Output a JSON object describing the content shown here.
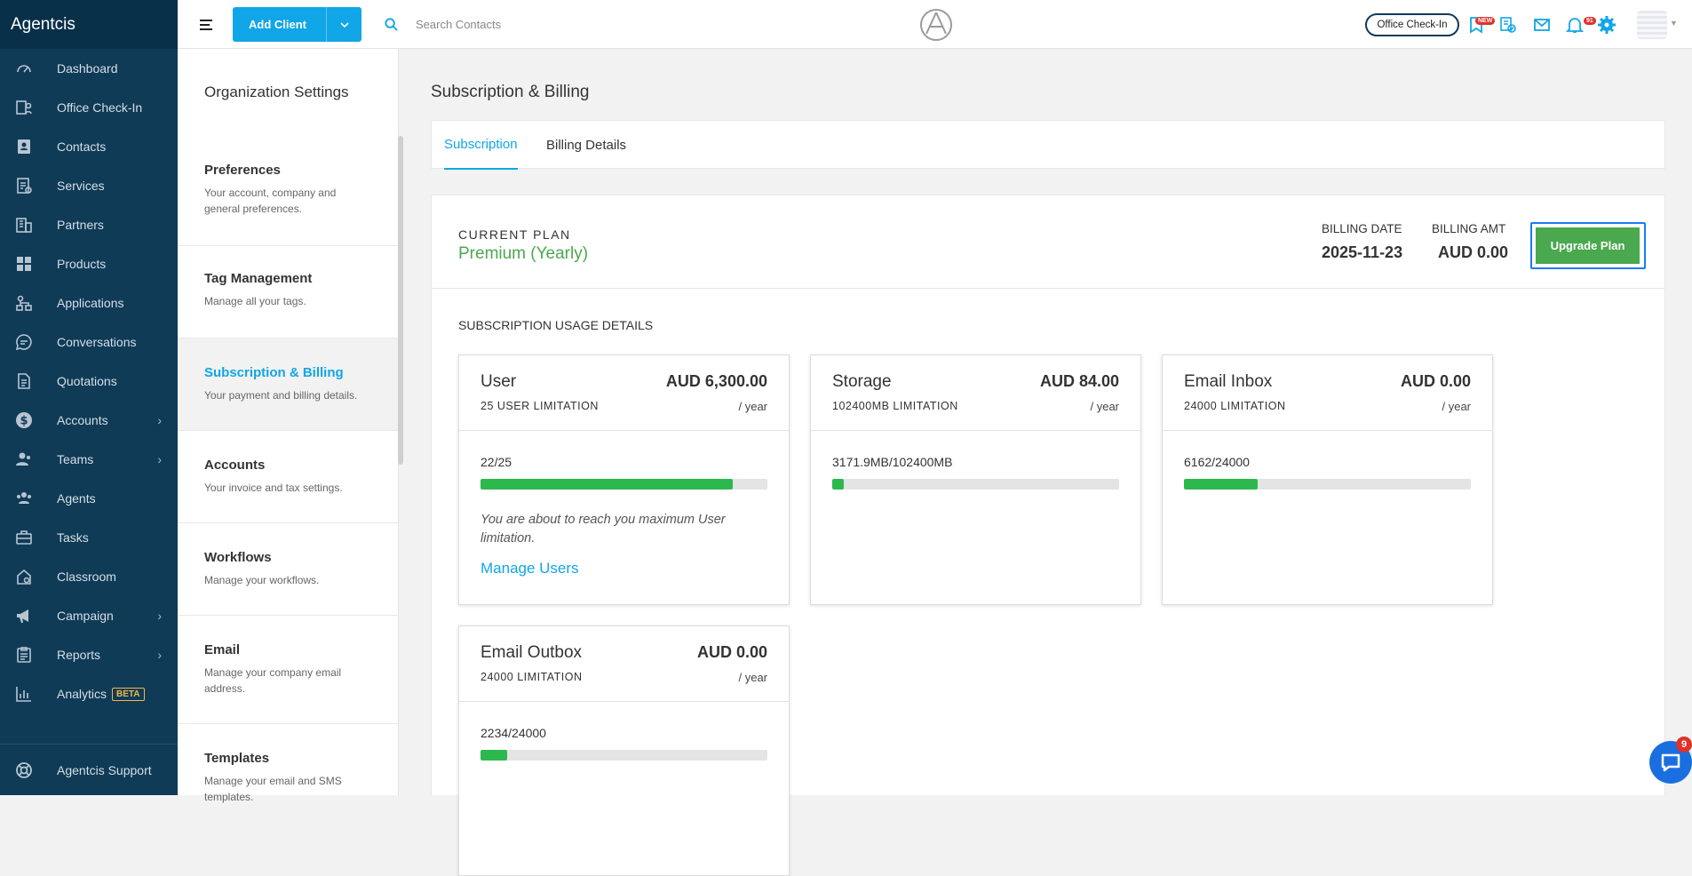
{
  "sidebar": {
    "brand": "Agentcis",
    "items": [
      {
        "label": "Dashboard",
        "icon": "gauge-icon",
        "chevron": false
      },
      {
        "label": "Office Check-In",
        "icon": "checkin-icon",
        "chevron": false
      },
      {
        "label": "Contacts",
        "icon": "contacts-icon",
        "chevron": false
      },
      {
        "label": "Services",
        "icon": "services-icon",
        "chevron": false
      },
      {
        "label": "Partners",
        "icon": "building-icon",
        "chevron": false
      },
      {
        "label": "Products",
        "icon": "products-icon",
        "chevron": false
      },
      {
        "label": "Applications",
        "icon": "applications-icon",
        "chevron": false
      },
      {
        "label": "Conversations",
        "icon": "chat-icon",
        "chevron": false
      },
      {
        "label": "Quotations",
        "icon": "document-icon",
        "chevron": false
      },
      {
        "label": "Accounts",
        "icon": "dollar-icon",
        "chevron": true
      },
      {
        "label": "Teams",
        "icon": "team-icon",
        "chevron": true
      },
      {
        "label": "Agents",
        "icon": "agents-icon",
        "chevron": false
      },
      {
        "label": "Tasks",
        "icon": "briefcase-icon",
        "chevron": false
      },
      {
        "label": "Classroom",
        "icon": "classroom-icon",
        "chevron": false
      },
      {
        "label": "Campaign",
        "icon": "megaphone-icon",
        "chevron": true
      },
      {
        "label": "Reports",
        "icon": "clipboard-icon",
        "chevron": true
      },
      {
        "label": "Analytics",
        "icon": "analytics-icon",
        "chevron": false,
        "badge": "BETA"
      }
    ],
    "support": "Agentcis Support"
  },
  "topbar": {
    "add_client": "Add Client",
    "search_placeholder": "Search Contacts",
    "office_checkin": "Office Check-In",
    "new_badge": "NEW",
    "notif_badge": "91"
  },
  "settings": {
    "title": "Organization Settings",
    "items": [
      {
        "title": "Preferences",
        "desc": "Your account, company and general preferences."
      },
      {
        "title": "Tag Management",
        "desc": "Manage all your tags."
      },
      {
        "title": "Subscription & Billing",
        "desc": "Your payment and billing details.",
        "active": true
      },
      {
        "title": "Accounts",
        "desc": "Your invoice and tax settings."
      },
      {
        "title": "Workflows",
        "desc": "Manage your workflows."
      },
      {
        "title": "Email",
        "desc": "Manage your company email address."
      },
      {
        "title": "Templates",
        "desc": "Manage your email and SMS templates."
      }
    ]
  },
  "main": {
    "title": "Subscription & Billing",
    "tabs": [
      "Subscription",
      "Billing Details"
    ],
    "current_plan_label": "CURRENT PLAN",
    "current_plan": "Premium (Yearly)",
    "billing_date_label": "BILLING DATE",
    "billing_date": "2025-11-23",
    "billing_amt_label": "BILLING AMT",
    "billing_amt": "AUD 0.00",
    "upgrade": "Upgrade Plan",
    "usage_title": "SUBSCRIPTION USAGE DETAILS",
    "cards": [
      {
        "name": "User",
        "price": "AUD 6,300.00",
        "limit": "25 USER LIMITATION",
        "per": "/ year",
        "used": "22/25",
        "fraction": 0.88,
        "warning": "You are about to reach you maximum User limitation.",
        "link": "Manage Users"
      },
      {
        "name": "Storage",
        "price": "AUD 84.00",
        "limit": "102400MB LIMITATION",
        "per": "/ year",
        "used": "3171.9MB/102400MB",
        "fraction": 0.031
      },
      {
        "name": "Email Inbox",
        "price": "AUD 0.00",
        "limit": "24000 LIMITATION",
        "per": "/ year",
        "used": "6162/24000",
        "fraction": 0.257
      },
      {
        "name": "Email Outbox",
        "price": "AUD 0.00",
        "limit": "24000 LIMITATION",
        "per": "/ year",
        "used": "2234/24000",
        "fraction": 0.093
      }
    ]
  },
  "chat": {
    "badge": "9"
  },
  "colors": {
    "sidebar": "#0f3b57",
    "accent": "#10a6e8",
    "green": "#4aa84e",
    "bar": "#2db84e"
  }
}
